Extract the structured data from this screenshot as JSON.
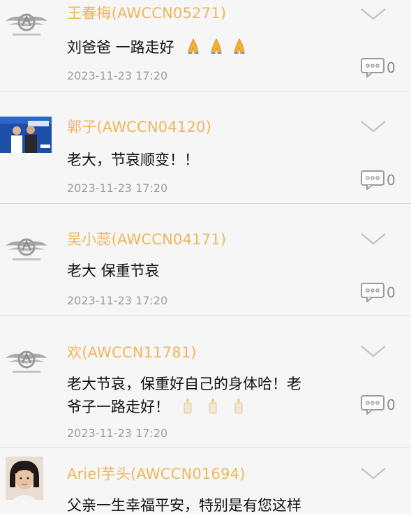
{
  "comments": [
    {
      "name": "王春梅(AWCCN05271)",
      "text": "刘爸爸 一路走好",
      "emoji": "pray",
      "date": "2023-11-23 17:20",
      "replies": "0",
      "avatar": "awc-logo-icon"
    },
    {
      "name": "郭子(AWCCN04120)",
      "text": "老大，节哀顺变！！",
      "date": "2023-11-23 17:20",
      "replies": "0",
      "avatar": "photo"
    },
    {
      "name": "吴小蕊(AWCCN04171)",
      "text": "老大 保重节哀",
      "date": "2023-11-23 17:20",
      "replies": "0",
      "avatar": "awc-logo-icon"
    },
    {
      "name": "欢(AWCCN11781)",
      "text_line1": "老大节哀，保重好自己的身体哈！老",
      "text_line2": "爷子一路走好！",
      "emoji": "candle",
      "date": "2023-11-23 17:20",
      "replies": "0",
      "avatar": "awc-logo-icon"
    },
    {
      "name": "Ariel芋头(AWCCN01694)",
      "text": "父亲一生幸福平安，特别是有您这样",
      "avatar": "photo"
    }
  ],
  "colors": {
    "name": "#eeb75c",
    "date": "#9c9c9c",
    "background": "#f6f6f6"
  }
}
